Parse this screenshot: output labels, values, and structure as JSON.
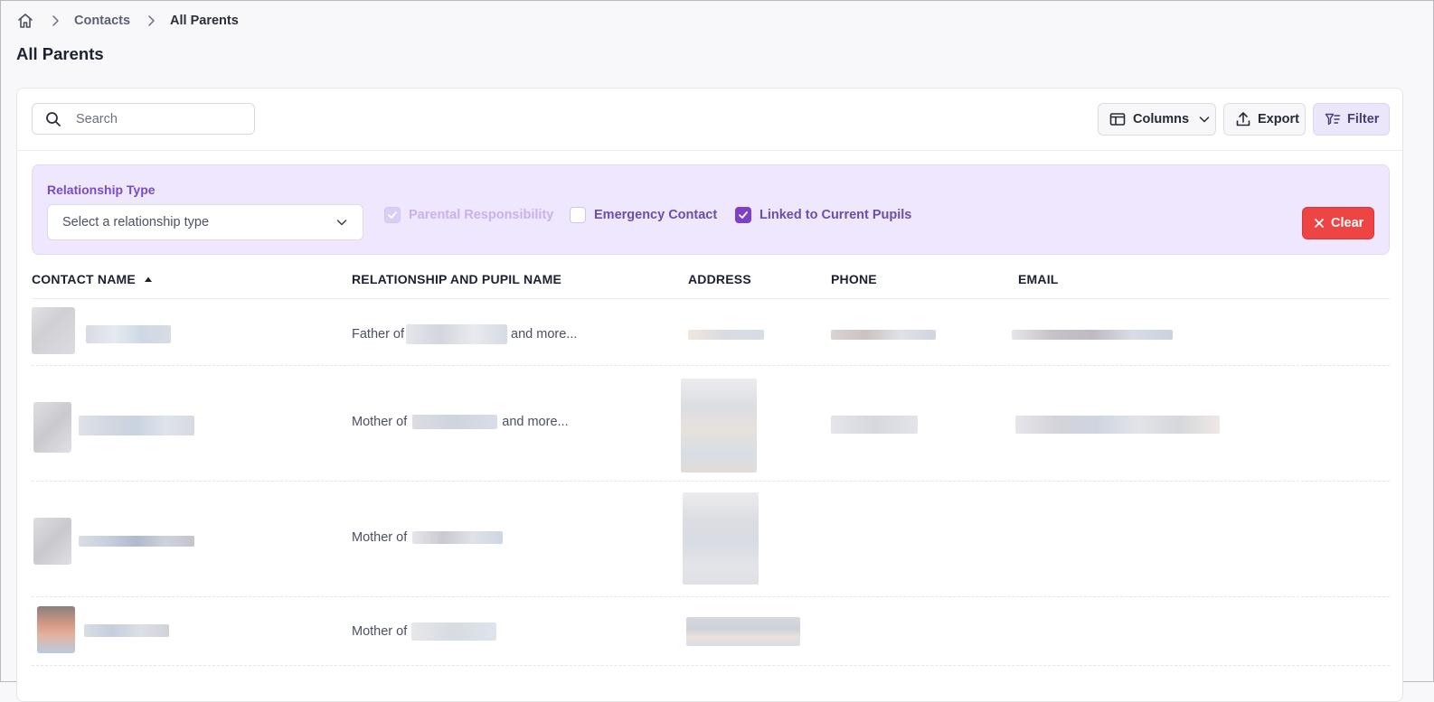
{
  "breadcrumb": {
    "home_icon": "home-icon",
    "separator_icon": "chevron-right-icon",
    "contacts": "Contacts",
    "current": "All Parents"
  },
  "page_title": "All Parents",
  "toolbar": {
    "search_placeholder": "Search",
    "search_value": "",
    "columns_label": "Columns",
    "export_label": "Export",
    "filter_label": "Filter"
  },
  "filters": {
    "relationship_type_label": "Relationship Type",
    "relationship_select_placeholder": "Select a relationship type",
    "checkboxes": [
      {
        "label": "Parental Responsibility",
        "checked": true,
        "disabled": true
      },
      {
        "label": "Emergency Contact",
        "checked": false,
        "disabled": false
      },
      {
        "label": "Linked to Current Pupils",
        "checked": true,
        "disabled": false
      }
    ],
    "clear_label": "Clear"
  },
  "table": {
    "columns": [
      "CONTACT NAME",
      "RELATIONSHIP AND PUPIL NAME",
      "ADDRESS",
      "PHONE",
      "EMAIL"
    ],
    "sorted_column": "CONTACT NAME",
    "sort_direction": "ascending",
    "rows": [
      {
        "relationship": "Father of",
        "more": "and more..."
      },
      {
        "relationship": "Mother of",
        "more": "and more..."
      },
      {
        "relationship": "Mother of",
        "more": ""
      },
      {
        "relationship": "Mother of",
        "more": ""
      }
    ]
  },
  "colors": {
    "accent": "#7e3fc9",
    "filter_panel_bg": "#efe7fd",
    "clear_button": "#ef4444"
  }
}
